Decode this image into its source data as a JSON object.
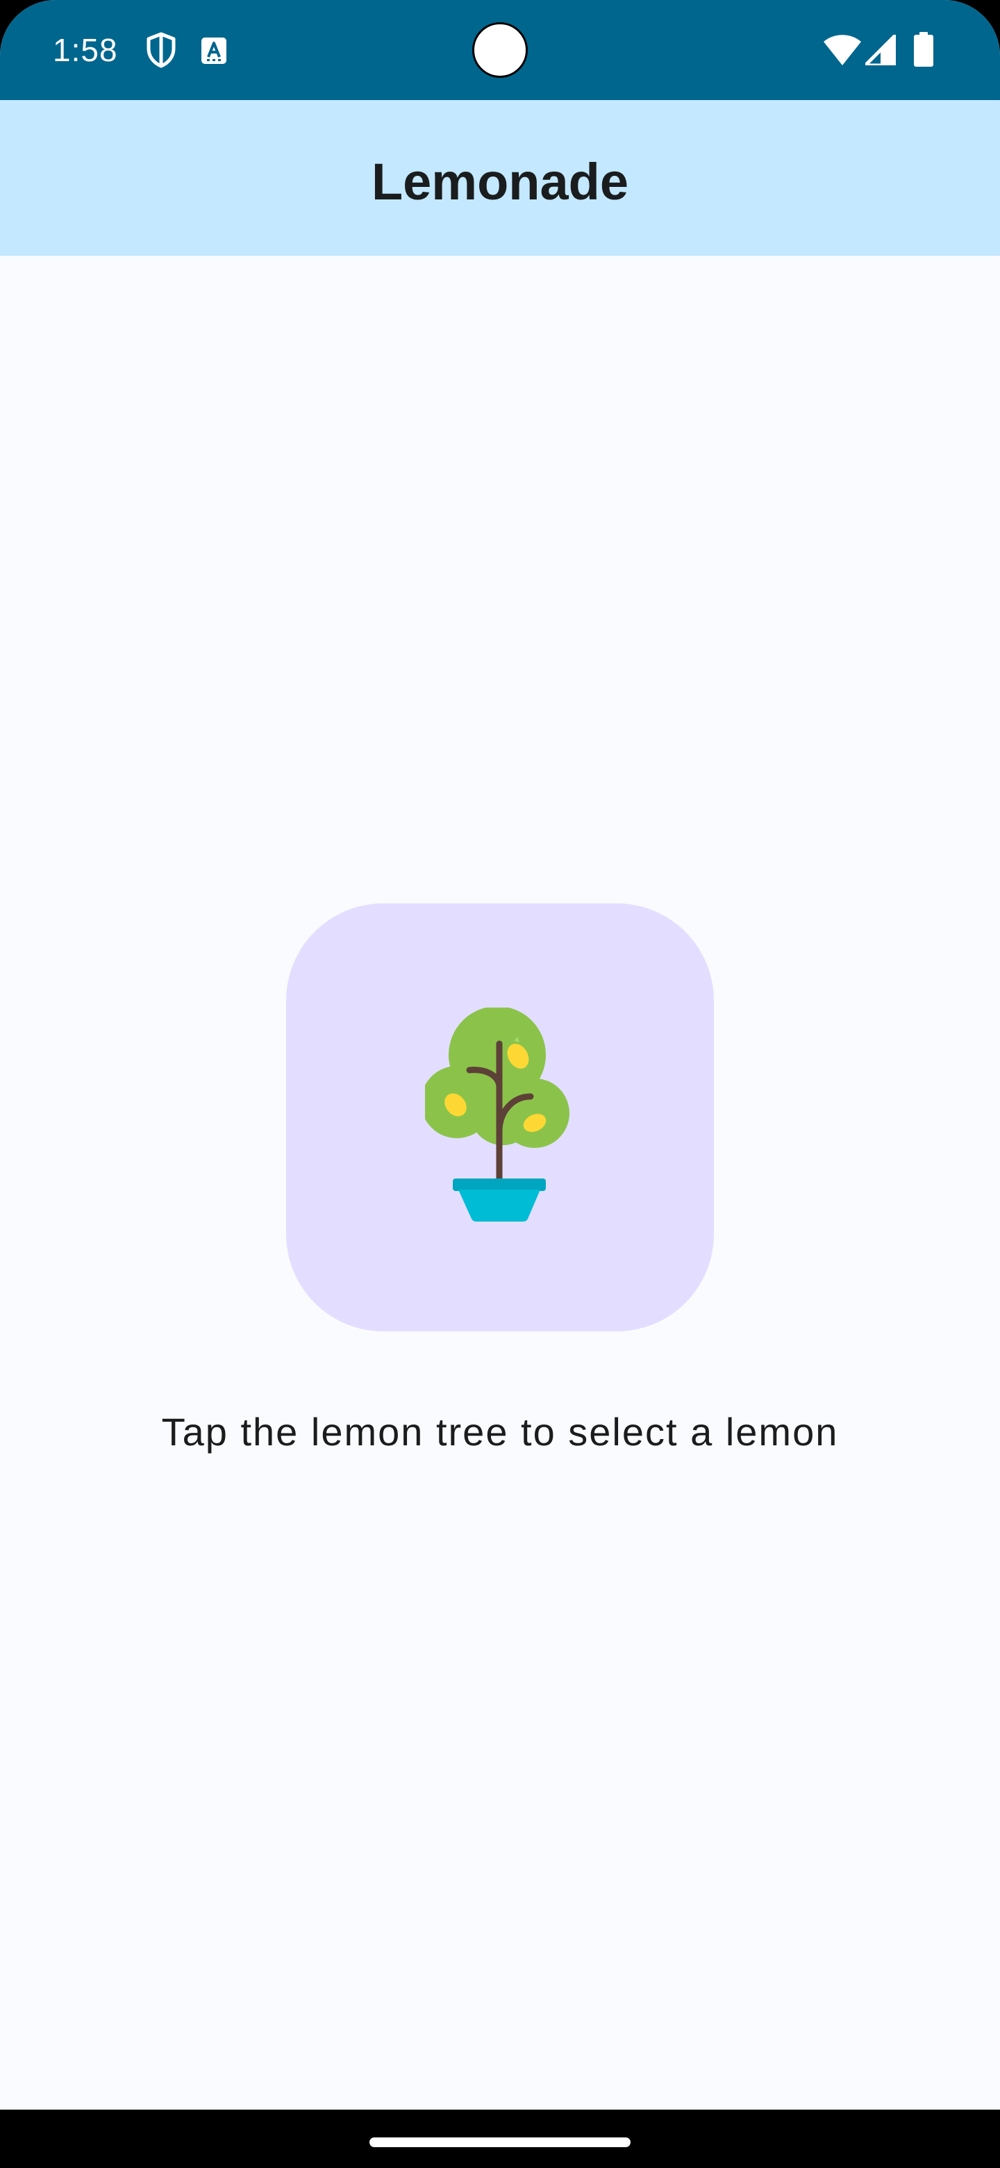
{
  "status_bar": {
    "time": "1:58",
    "left_icons": [
      "shield-icon",
      "accessibility-a-icon"
    ],
    "right_icons": [
      "wifi-icon",
      "cell-signal-icon",
      "battery-icon"
    ],
    "background": "#00668E"
  },
  "app_bar": {
    "title": "Lemonade",
    "background": "#C3E8FF"
  },
  "main": {
    "image_icon": "lemon-tree-icon",
    "image_background": "#E3DEFF",
    "instruction": "Tap the lemon tree to select a lemon"
  },
  "nav_bar": {
    "handle": "home-gesture-handle"
  }
}
